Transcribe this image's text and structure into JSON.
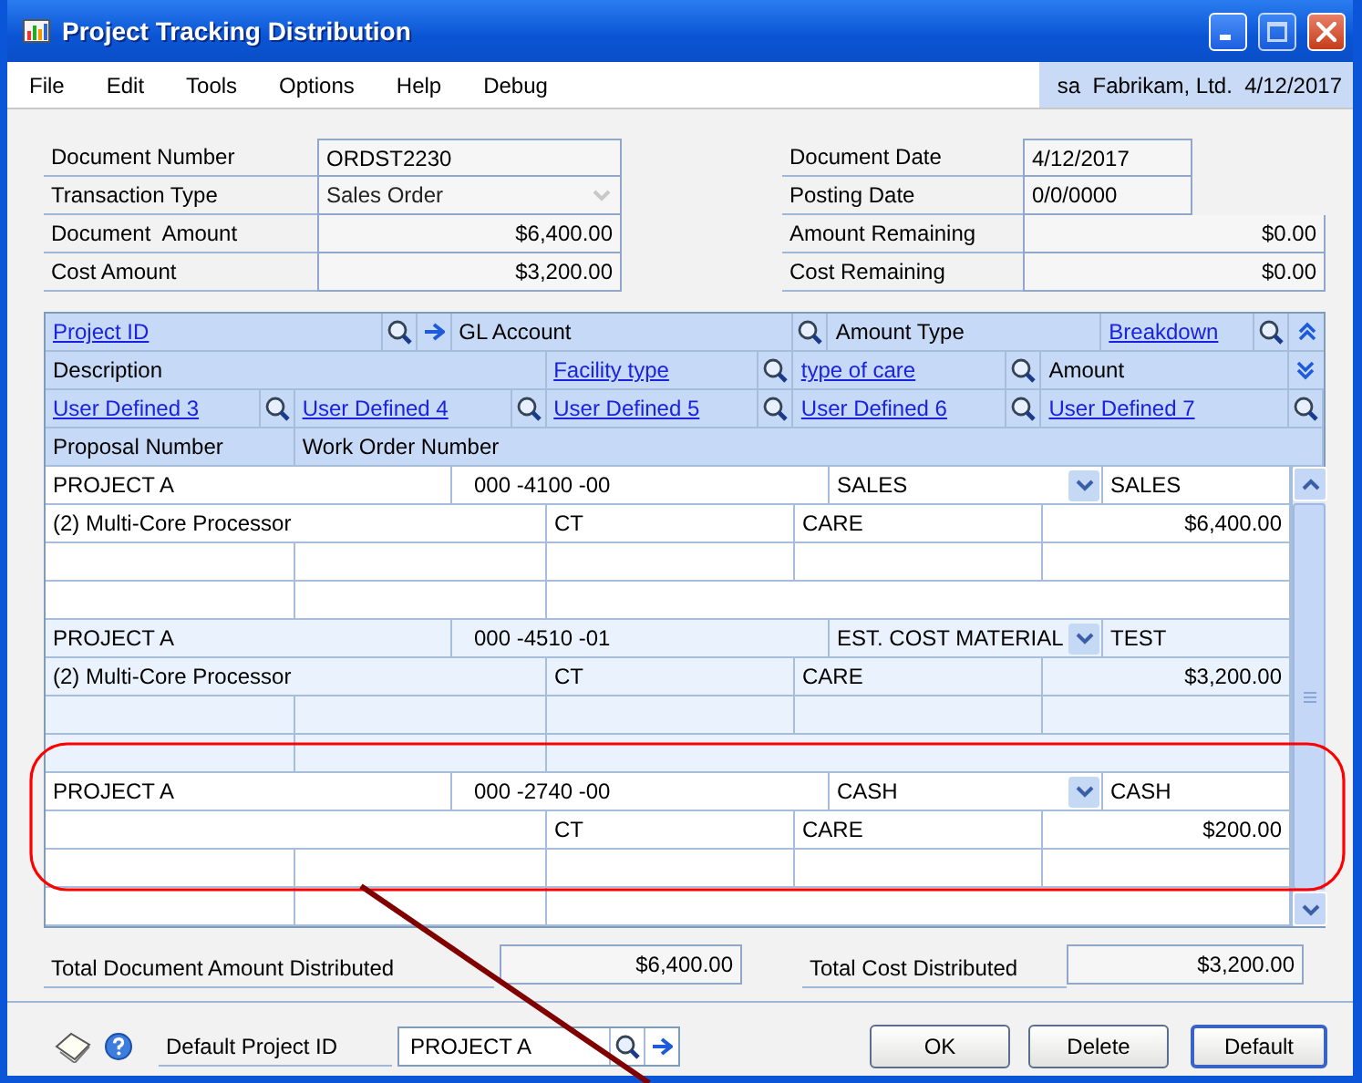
{
  "window": {
    "title": "Project Tracking Distribution"
  },
  "menu": {
    "items": [
      "File",
      "Edit",
      "Tools",
      "Options",
      "Help",
      "Debug"
    ],
    "user_info": "sa  Fabrikam, Ltd.  4/12/2017"
  },
  "fields_left": [
    {
      "label": "Document Number",
      "value": "ORDST2230",
      "kind": "text"
    },
    {
      "label": "Transaction Type",
      "value": "Sales Order",
      "kind": "dropdown",
      "disabled": true
    },
    {
      "label": "Document  Amount",
      "value": "$6,400.00",
      "kind": "amount"
    },
    {
      "label": "Cost Amount",
      "value": "$3,200.00",
      "kind": "amount"
    }
  ],
  "fields_right": [
    {
      "label": "Document Date",
      "value": "4/12/2017",
      "kind": "date"
    },
    {
      "label": "Posting Date",
      "value": "0/0/0000",
      "kind": "date"
    },
    {
      "label": "Amount Remaining",
      "value": "$0.00",
      "kind": "amount"
    },
    {
      "label": "Cost Remaining",
      "value": "$0.00",
      "kind": "amount"
    }
  ],
  "grid": {
    "header_rows": [
      {
        "kind": "collapse",
        "cells": [
          {
            "label": "Project ID",
            "kind": "link",
            "lookup": true,
            "jump": true
          },
          {
            "label": "GL Account",
            "kind": "label",
            "lookup": true,
            "jump": false
          },
          {
            "label": "Amount Type",
            "kind": "label",
            "lookup": false,
            "jump": false
          },
          {
            "label": "Breakdown",
            "kind": "link",
            "lookup": true,
            "jump": false
          }
        ]
      },
      {
        "kind": "expand",
        "cells": [
          {
            "label": "Description",
            "kind": "label",
            "lookup": false,
            "jump": false
          },
          {
            "label": "Facility type",
            "kind": "link",
            "lookup": true,
            "jump": false
          },
          {
            "label": "type of care",
            "kind": "link",
            "lookup": true,
            "jump": false
          },
          {
            "label": "Amount",
            "kind": "label",
            "lookup": false,
            "jump": false
          }
        ]
      },
      {
        "kind": "plain",
        "cells": [
          {
            "label": "User Defined 3",
            "kind": "link",
            "lookup": true,
            "jump": false
          },
          {
            "label": "User Defined 4",
            "kind": "link",
            "lookup": true,
            "jump": false
          },
          {
            "label": "User Defined 5",
            "kind": "link",
            "lookup": true,
            "jump": false
          },
          {
            "label": "User Defined 6",
            "kind": "link",
            "lookup": true,
            "jump": false
          },
          {
            "label": "User Defined 7",
            "kind": "link",
            "lookup": true,
            "jump": false
          }
        ]
      },
      {
        "kind": "plain",
        "cells": [
          {
            "label": "Proposal Number",
            "kind": "label",
            "lookup": false,
            "jump": false
          },
          {
            "label": "Work Order Number",
            "kind": "label",
            "lookup": false,
            "jump": false
          }
        ]
      }
    ],
    "records": [
      {
        "project": "PROJECT A",
        "account": "000 -4100 -00",
        "amount_type": "SALES",
        "breakdown": "SALES",
        "description": "(2) Multi-Core Processor",
        "facility": "CT",
        "care": "CARE",
        "amount": "$6,400.00"
      },
      {
        "project": "PROJECT A",
        "account": "000 -4510 -01",
        "amount_type": "EST. COST MATERIAL",
        "breakdown": "TEST",
        "description": "(2) Multi-Core Processor",
        "facility": "CT",
        "care": "CARE",
        "amount": "$3,200.00"
      },
      {
        "project": "PROJECT A",
        "account": "000 -2740 -00",
        "amount_type": "CASH",
        "breakdown": "CASH",
        "facility": "CT",
        "care": "CARE",
        "amount": "$200.00"
      }
    ]
  },
  "totals": [
    {
      "label": "Total Document Amount Distributed",
      "value": "$6,400.00"
    },
    {
      "label": "Total Cost Distributed",
      "value": "$3,200.00"
    }
  ],
  "footer": {
    "default_project_label": "Default Project ID",
    "default_project_value": "PROJECT A",
    "buttons": [
      {
        "label": "OK",
        "default": false
      },
      {
        "label": "Delete",
        "default": false
      },
      {
        "label": "Default",
        "default": true
      }
    ]
  },
  "markup": [
    {
      "kind": "outline",
      "color": "#ff0000"
    },
    {
      "kind": "line",
      "color": "#800000"
    }
  ]
}
